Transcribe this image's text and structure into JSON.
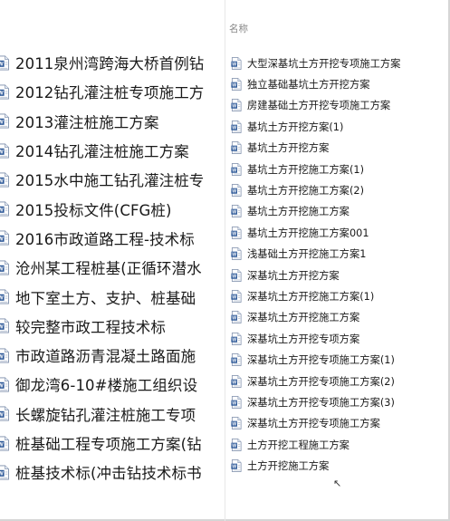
{
  "left": {
    "header_text": "",
    "items": [
      {
        "label": "2011泉州湾跨海大桥首例钻"
      },
      {
        "label": "2012钻孔灌注桩专项施工方"
      },
      {
        "label": "2013灌注桩施工方案"
      },
      {
        "label": "2014钻孔灌注桩施工方案"
      },
      {
        "label": "2015水中施工钻孔灌注桩专"
      },
      {
        "label": "2015投标文件(CFG桩)"
      },
      {
        "label": "2016市政道路工程-技术标"
      },
      {
        "label": "沧州某工程桩基(正循环潜水"
      },
      {
        "label": "地下室土方、支护、桩基础"
      },
      {
        "label": "较完整市政工程技术标"
      },
      {
        "label": "市政道路沥青混凝土路面施"
      },
      {
        "label": "御龙湾6-10#楼施工组织设"
      },
      {
        "label": "长螺旋钻孔灌注桩施工专项"
      },
      {
        "label": "桩基础工程专项施工方案(钻"
      },
      {
        "label": "桩基技术标(冲击钻技术标书"
      }
    ]
  },
  "right": {
    "column_header": "名称",
    "items": [
      {
        "label": "大型深基坑土方开挖专项施工方案"
      },
      {
        "label": "独立基础基坑土方开挖方案"
      },
      {
        "label": "房建基础土方开挖专项施工方案"
      },
      {
        "label": "基坑土方开挖方案(1)"
      },
      {
        "label": "基坑土方开挖方案"
      },
      {
        "label": "基坑土方开挖施工方案(1)"
      },
      {
        "label": "基坑土方开挖施工方案(2)"
      },
      {
        "label": "基坑土方开挖施工方案"
      },
      {
        "label": "基坑土方开挖施工方案001"
      },
      {
        "label": "浅基础土方开挖施工方案1"
      },
      {
        "label": "深基坑土方开挖方案"
      },
      {
        "label": "深基坑土方开挖施工方案(1)"
      },
      {
        "label": "深基坑土方开挖施工方案"
      },
      {
        "label": "深基坑土方开挖专项方案"
      },
      {
        "label": "深基坑土方开挖专项施工方案(1)"
      },
      {
        "label": "深基坑土方开挖专项施工方案(2)"
      },
      {
        "label": "深基坑土方开挖专项施工方案(3)"
      },
      {
        "label": "深基坑土方开挖专项施工方案"
      },
      {
        "label": "土方开挖工程施工方案"
      },
      {
        "label": "土方开挖施工方案"
      }
    ]
  },
  "icons": {
    "file": "word-document-icon"
  },
  "colors": {
    "icon_blue": "#2b5797",
    "text": "#1a1a1a",
    "header_gray": "#888888"
  }
}
